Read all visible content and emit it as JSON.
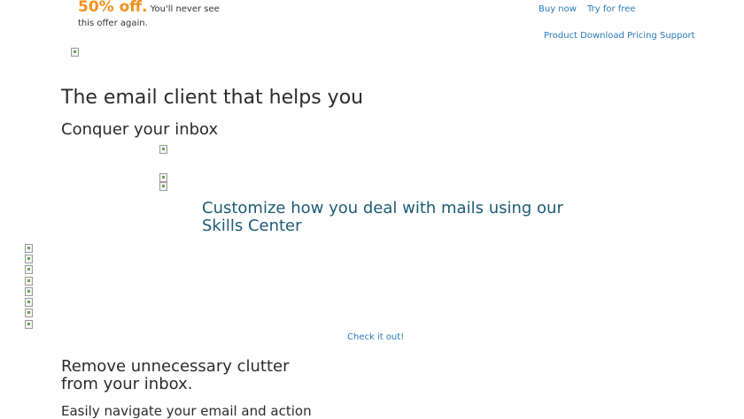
{
  "promo": {
    "highlight": "50% off.",
    "text_line1": "You'll never see",
    "text_line2": "this offer again."
  },
  "header_links": {
    "buy_now": "Buy now",
    "try_free": "Try for free"
  },
  "nav": {
    "items": [
      "Product",
      "Download",
      "Pricing",
      "Support"
    ]
  },
  "hero": {
    "title": "The email client that helps you",
    "subtitle": "Conquer your inbox"
  },
  "skills": {
    "heading": "Customize how you deal with mails using our Skills Center",
    "link": "Check it out!"
  },
  "clutter": {
    "heading": "Remove unnecessary clutter from your inbox."
  },
  "navigate": {
    "heading": "Easily navigate your email and action"
  },
  "colors": {
    "promo_accent": "#f0921e",
    "link": "#2b7bb9",
    "skills_heading": "#1d5b73"
  }
}
